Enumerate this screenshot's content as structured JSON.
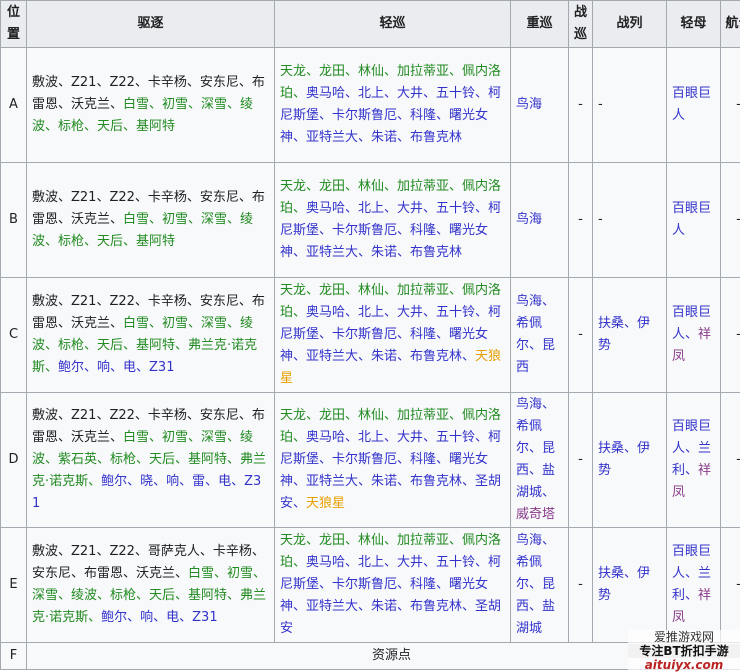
{
  "headers": [
    "位置",
    "驱逐",
    "轻巡",
    "重巡",
    "战巡",
    "战列",
    "轻母",
    "航母"
  ],
  "rows": [
    {
      "pos": "A",
      "dd": [
        {
          "t": "敷波、Z21、Z22、卡辛杨、安东尼、布雷恩、沃克兰、",
          "c": "black"
        },
        {
          "t": "白雪、初雪、深雪、绫波、标枪、天后、基阿特",
          "c": "green"
        }
      ],
      "cl": [
        {
          "t": "天龙、龙田、林仙、加拉蒂亚、佩内洛珀、",
          "c": "green"
        },
        {
          "t": "奥马哈、北上、大井、五十铃、柯尼斯堡、卡尔斯鲁厄、科隆、曙光女神、亚特兰大、朱诺、布鲁克林",
          "c": "blue"
        }
      ],
      "ca": [
        {
          "t": "鸟海",
          "c": "blue"
        }
      ],
      "bc": [
        {
          "t": "-",
          "c": "black"
        }
      ],
      "bb": [
        {
          "t": "-",
          "c": "black"
        }
      ],
      "cvl": [
        {
          "t": "百眼巨人",
          "c": "blue"
        }
      ],
      "cv": [
        {
          "t": "-",
          "c": "black"
        }
      ]
    },
    {
      "pos": "B",
      "dd": [
        {
          "t": "敷波、Z21、Z22、卡辛杨、安东尼、布雷恩、沃克兰、",
          "c": "black"
        },
        {
          "t": "白雪、初雪、深雪、绫波、标枪、天后、基阿特",
          "c": "green"
        }
      ],
      "cl": [
        {
          "t": "天龙、龙田、林仙、加拉蒂亚、佩内洛珀、",
          "c": "green"
        },
        {
          "t": "奥马哈、北上、大井、五十铃、柯尼斯堡、卡尔斯鲁厄、科隆、曙光女神、亚特兰大、朱诺、布鲁克林",
          "c": "blue"
        }
      ],
      "ca": [
        {
          "t": "鸟海",
          "c": "blue"
        }
      ],
      "bc": [
        {
          "t": "-",
          "c": "black"
        }
      ],
      "bb": [
        {
          "t": "-",
          "c": "black"
        }
      ],
      "cvl": [
        {
          "t": "百眼巨人",
          "c": "blue"
        }
      ],
      "cv": [
        {
          "t": "-",
          "c": "black"
        }
      ]
    },
    {
      "pos": "C",
      "dd": [
        {
          "t": "敷波、Z21、Z22、卡辛杨、安东尼、布雷恩、沃克兰、",
          "c": "black"
        },
        {
          "t": "白雪、初雪、深雪、绫波、标枪、天后、基阿特、弗兰克·诺克斯、",
          "c": "green"
        },
        {
          "t": "鲍尔、响、电、Z31",
          "c": "blue"
        }
      ],
      "cl": [
        {
          "t": "天龙、龙田、林仙、加拉蒂亚、佩内洛珀、",
          "c": "green"
        },
        {
          "t": "奥马哈、北上、大井、五十铃、柯尼斯堡、卡尔斯鲁厄、科隆、曙光女神、亚特兰大、朱诺、布鲁克林、",
          "c": "blue"
        },
        {
          "t": "天狼星",
          "c": "orange"
        }
      ],
      "ca": [
        {
          "t": "鸟海、希佩尔、昆西",
          "c": "blue"
        }
      ],
      "bc": [
        {
          "t": "-",
          "c": "black"
        }
      ],
      "bb": [
        {
          "t": "扶桑、伊势",
          "c": "blue"
        }
      ],
      "cvl": [
        {
          "t": "百眼巨人、",
          "c": "blue"
        },
        {
          "t": "祥凤",
          "c": "purple"
        }
      ],
      "cv": [
        {
          "t": "-",
          "c": "black"
        }
      ]
    },
    {
      "pos": "D",
      "dd": [
        {
          "t": "敷波、Z21、Z22、卡辛杨、安东尼、布雷恩、沃克兰、",
          "c": "black"
        },
        {
          "t": "白雪、初雪、深雪、绫波、紫石英、标枪、天后、基阿特、弗兰克·诺克斯、",
          "c": "green"
        },
        {
          "t": "鲍尔、晓、响、雷、电、Z31",
          "c": "blue"
        }
      ],
      "cl": [
        {
          "t": "天龙、龙田、林仙、加拉蒂亚、佩内洛珀、",
          "c": "green"
        },
        {
          "t": "奥马哈、北上、大井、五十铃、柯尼斯堡、卡尔斯鲁厄、科隆、曙光女神、亚特兰大、朱诺、布鲁克林、圣胡安、",
          "c": "blue"
        },
        {
          "t": "天狼星",
          "c": "orange"
        }
      ],
      "ca": [
        {
          "t": "鸟海、希佩尔、昆西、盐湖城、",
          "c": "blue"
        },
        {
          "t": "威奇塔",
          "c": "purple"
        }
      ],
      "bc": [
        {
          "t": "-",
          "c": "black"
        }
      ],
      "bb": [
        {
          "t": "扶桑、伊势",
          "c": "blue"
        }
      ],
      "cvl": [
        {
          "t": "百眼巨人、兰利、",
          "c": "blue"
        },
        {
          "t": "祥凤",
          "c": "purple"
        }
      ],
      "cv": [
        {
          "t": "-",
          "c": "black"
        }
      ]
    },
    {
      "pos": "E",
      "dd": [
        {
          "t": "敷波、Z21、Z22、哥萨克人、卡辛杨、安东尼、布雷恩、沃克兰、",
          "c": "black"
        },
        {
          "t": "白雪、初雪、深雪、绫波、标枪、天后、基阿特、弗兰克·诺克斯、",
          "c": "green"
        },
        {
          "t": "鲍尔、响、电、Z31",
          "c": "blue"
        }
      ],
      "cl": [
        {
          "t": "天龙、龙田、林仙、加拉蒂亚、佩内洛珀、",
          "c": "green"
        },
        {
          "t": "奥马哈、北上、大井、五十铃、柯尼斯堡、卡尔斯鲁厄、科隆、曙光女神、亚特兰大、朱诺、布鲁克林、圣胡安",
          "c": "blue"
        }
      ],
      "ca": [
        {
          "t": "鸟海、希佩尔、昆西、盐湖城",
          "c": "blue"
        }
      ],
      "bc": [
        {
          "t": "-",
          "c": "black"
        }
      ],
      "bb": [
        {
          "t": "扶桑、伊势",
          "c": "blue"
        }
      ],
      "cvl": [
        {
          "t": "百眼巨人、兰利、",
          "c": "blue"
        },
        {
          "t": "祥凤",
          "c": "purple"
        }
      ],
      "cv": [
        {
          "t": "-",
          "c": "black"
        }
      ]
    }
  ],
  "last_row": {
    "pos": "F",
    "text": "资源点"
  },
  "watermark": {
    "line1": "爱推游戏网",
    "line2": "专注BT折扣手游",
    "line3": "aituiyx.com"
  },
  "colors": {
    "black": "#202122",
    "green": "#228b22",
    "blue": "#3333cc",
    "purple": "#8a3a8a",
    "orange": "#e8a000",
    "red": "#b8323d",
    "header_bg": "#eaecf0",
    "cell_bg": "#f8f9fa",
    "border": "#a2a9b1"
  }
}
